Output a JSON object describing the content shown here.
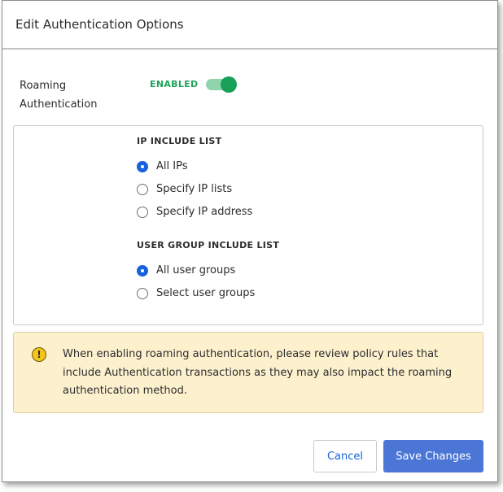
{
  "dialog": {
    "title": "Edit Authentication Options"
  },
  "roaming": {
    "label_line1": "Roaming",
    "label_line2": "Authentication",
    "status": "ENABLED",
    "enabled": true
  },
  "ip_list": {
    "heading": "IP INCLUDE LIST",
    "options": [
      "All IPs",
      "Specify IP lists",
      "Specify IP address"
    ],
    "selected": 0
  },
  "group_list": {
    "heading": "USER GROUP INCLUDE LIST",
    "options": [
      "All user groups",
      "Select user groups"
    ],
    "selected": 0
  },
  "warning": {
    "icon": "exclamation-icon",
    "text": "When enabling roaming authentication, please review policy rules that include Authentication transactions as they may also impact the roaming authentication method."
  },
  "buttons": {
    "cancel": "Cancel",
    "save": "Save Changes"
  },
  "colors": {
    "accent": "#4b76d6",
    "enabled": "#18a058",
    "warning_bg": "#fdf1cd"
  }
}
